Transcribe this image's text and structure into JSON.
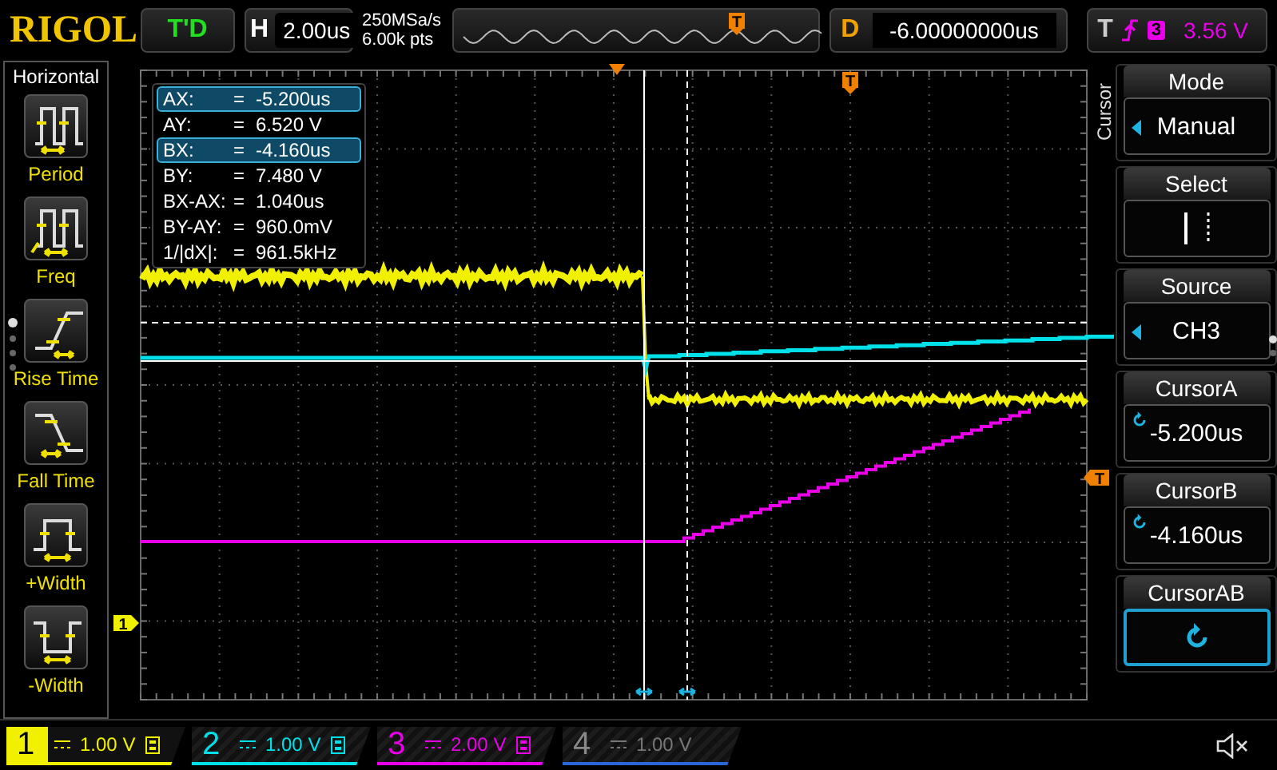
{
  "header": {
    "logo": "RIGOL",
    "status": "T'D",
    "timebase": {
      "label": "H",
      "value": "2.00us"
    },
    "sample_rate": "250MSa/s",
    "memory_depth": "6.00k pts",
    "overview_marker": "T",
    "delay": {
      "label": "D",
      "value": "-6.00000000us"
    },
    "trigger": {
      "label": "T",
      "source": "3",
      "level": "3.56 V"
    }
  },
  "left_menu": {
    "title": "Horizontal",
    "items": [
      {
        "kind": "period",
        "label": "Period"
      },
      {
        "kind": "freq",
        "label": "Freq"
      },
      {
        "kind": "rise",
        "label": "Rise Time"
      },
      {
        "kind": "fall",
        "label": "Fall Time"
      },
      {
        "kind": "pwidth",
        "label": "+Width"
      },
      {
        "kind": "nwidth",
        "label": "-Width"
      }
    ]
  },
  "screen": {
    "markers": {
      "trigger_position": "T",
      "trigger_level": "T",
      "channel": "1"
    },
    "readouts": [
      {
        "label": "AX:",
        "equals": "=",
        "value": "-5.200us",
        "selected": true
      },
      {
        "label": "AY:",
        "equals": "=",
        "value": "6.520 V",
        "selected": false
      },
      {
        "label": "BX:",
        "equals": "=",
        "value": "-4.160us",
        "selected": true
      },
      {
        "label": "BY:",
        "equals": "=",
        "value": "7.480 V",
        "selected": false
      },
      {
        "label": "BX-AX:",
        "equals": "=",
        "value": "1.040us",
        "selected": false
      },
      {
        "label": "BY-AY:",
        "equals": "=",
        "value": "960.0mV",
        "selected": false
      },
      {
        "label": "1/|dX|:",
        "equals": "=",
        "value": "961.5kHz",
        "selected": false
      }
    ]
  },
  "right_menu": {
    "title": "Cursor",
    "items": [
      {
        "kind": "choice",
        "title": "Mode",
        "value": "Manual"
      },
      {
        "kind": "select",
        "title": "Select"
      },
      {
        "kind": "choice",
        "title": "Source",
        "value": "CH3"
      },
      {
        "kind": "knob",
        "title": "CursorA",
        "value": "-5.200us"
      },
      {
        "kind": "knob",
        "title": "CursorB",
        "value": "-4.160us"
      },
      {
        "kind": "action",
        "title": "CursorAB"
      }
    ]
  },
  "channels": [
    {
      "number": "1",
      "scale": "1.00 V",
      "color": "#f0f000",
      "on": true,
      "selected": true
    },
    {
      "number": "2",
      "scale": "1.00 V",
      "color": "#00e0e8",
      "on": true,
      "selected": false
    },
    {
      "number": "3",
      "scale": "2.00 V",
      "color": "#e800e8",
      "on": true,
      "selected": false
    },
    {
      "number": "4",
      "scale": "1.00 V",
      "color": "#2a66d8",
      "on": false,
      "selected": false
    }
  ]
}
